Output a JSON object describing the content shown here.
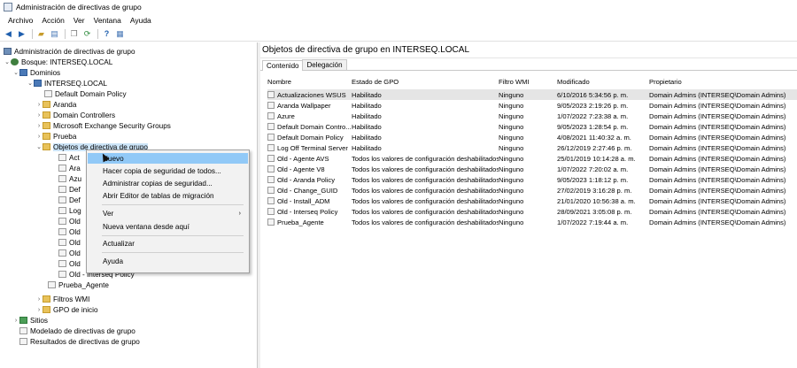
{
  "window": {
    "title": "Administración de directivas de grupo"
  },
  "menubar": [
    "Archivo",
    "Acción",
    "Ver",
    "Ventana",
    "Ayuda"
  ],
  "toolbar": {
    "icons": [
      "back-icon",
      "forward-icon",
      "up-folder-icon",
      "show-tree-icon",
      "copy-icon",
      "refresh-icon",
      "help-icon",
      "properties-icon"
    ]
  },
  "tree": {
    "root": "Administración de directivas de grupo",
    "forest": "Bosque: INTERSEQ.LOCAL",
    "domains": "Dominios",
    "domain": "INTERSEQ.LOCAL",
    "items": [
      "Default Domain Policy",
      "Aranda",
      "Domain Controllers",
      "Microsoft Exchange Security Groups",
      "Prueba",
      "Objetos de directiva de grupo"
    ],
    "gpo_children_visible": [
      "Act",
      "Ara",
      "Azu",
      "Def",
      "Def",
      "Log",
      "Old",
      "Old",
      "Old",
      "Old",
      "Old",
      "Old - Interseq Policy",
      "Prueba_Agente"
    ],
    "wmi": "Filtros WMI",
    "starter": "GPO de inicio",
    "sites": "Sitios",
    "modeling": "Modelado de directivas de grupo",
    "results": "Resultados de directivas de grupo"
  },
  "right": {
    "header": "Objetos de directiva de grupo en INTERSEQ.LOCAL",
    "tabs": [
      "Contenido",
      "Delegación"
    ],
    "columns": [
      "Nombre",
      "Estado de GPO",
      "Filtro WMI",
      "Modificado",
      "Propietario"
    ],
    "rows": [
      {
        "name": "Actualizaciones WSUS",
        "status": "Habilitado",
        "wmi": "Ninguno",
        "modified": "6/10/2016 5:34:56 p. m.",
        "owner": "Domain Admins (INTERSEQ\\Domain Admins)"
      },
      {
        "name": "Aranda Wallpaper",
        "status": "Habilitado",
        "wmi": "Ninguno",
        "modified": "9/05/2023 2:19:26 p. m.",
        "owner": "Domain Admins (INTERSEQ\\Domain Admins)"
      },
      {
        "name": "Azure",
        "status": "Habilitado",
        "wmi": "Ninguno",
        "modified": "1/07/2022 7:23:38 a. m.",
        "owner": "Domain Admins (INTERSEQ\\Domain Admins)"
      },
      {
        "name": "Default Domain Contro...",
        "status": "Habilitado",
        "wmi": "Ninguno",
        "modified": "9/05/2023 1:28:54 p. m.",
        "owner": "Domain Admins (INTERSEQ\\Domain Admins)"
      },
      {
        "name": "Default Domain Policy",
        "status": "Habilitado",
        "wmi": "Ninguno",
        "modified": "4/08/2021 11:40:32 a. m.",
        "owner": "Domain Admins (INTERSEQ\\Domain Admins)"
      },
      {
        "name": "Log Off Terminal Server",
        "status": "Habilitado",
        "wmi": "Ninguno",
        "modified": "26/12/2019 2:27:46 p. m.",
        "owner": "Domain Admins (INTERSEQ\\Domain Admins)"
      },
      {
        "name": "Old - Agente AVS",
        "status": "Todos los valores de configuración deshabilitados",
        "wmi": "Ninguno",
        "modified": "25/01/2019 10:14:28 a. m.",
        "owner": "Domain Admins (INTERSEQ\\Domain Admins)"
      },
      {
        "name": "Old - Agente V8",
        "status": "Todos los valores de configuración deshabilitados",
        "wmi": "Ninguno",
        "modified": "1/07/2022 7:20:02 a. m.",
        "owner": "Domain Admins (INTERSEQ\\Domain Admins)"
      },
      {
        "name": "Old - Aranda Policy",
        "status": "Todos los valores de configuración deshabilitados",
        "wmi": "Ninguno",
        "modified": "9/05/2023 1:18:12 p. m.",
        "owner": "Domain Admins (INTERSEQ\\Domain Admins)"
      },
      {
        "name": "Old - Change_GUID",
        "status": "Todos los valores de configuración deshabilitados",
        "wmi": "Ninguno",
        "modified": "27/02/2019 3:16:28 p. m.",
        "owner": "Domain Admins (INTERSEQ\\Domain Admins)"
      },
      {
        "name": "Old - Install_ADM",
        "status": "Todos los valores de configuración deshabilitados",
        "wmi": "Ninguno",
        "modified": "21/01/2020 10:56:38 a. m.",
        "owner": "Domain Admins (INTERSEQ\\Domain Admins)"
      },
      {
        "name": "Old - Interseq Policy",
        "status": "Todos los valores de configuración deshabilitados",
        "wmi": "Ninguno",
        "modified": "28/09/2021 3:05:08 p. m.",
        "owner": "Domain Admins (INTERSEQ\\Domain Admins)"
      },
      {
        "name": "Prueba_Agente",
        "status": "Todos los valores de configuración deshabilitados",
        "wmi": "Ninguno",
        "modified": "1/07/2022 7:19:44 a. m.",
        "owner": "Domain Admins (INTERSEQ\\Domain Admins)"
      }
    ]
  },
  "context_menu": {
    "items": [
      "Nuevo",
      "Hacer copia de seguridad de todos...",
      "Administrar copias de seguridad...",
      "Abrir Editor de tablas de migración",
      "Ver",
      "Nueva ventana desde aquí",
      "Actualizar",
      "Ayuda"
    ]
  }
}
